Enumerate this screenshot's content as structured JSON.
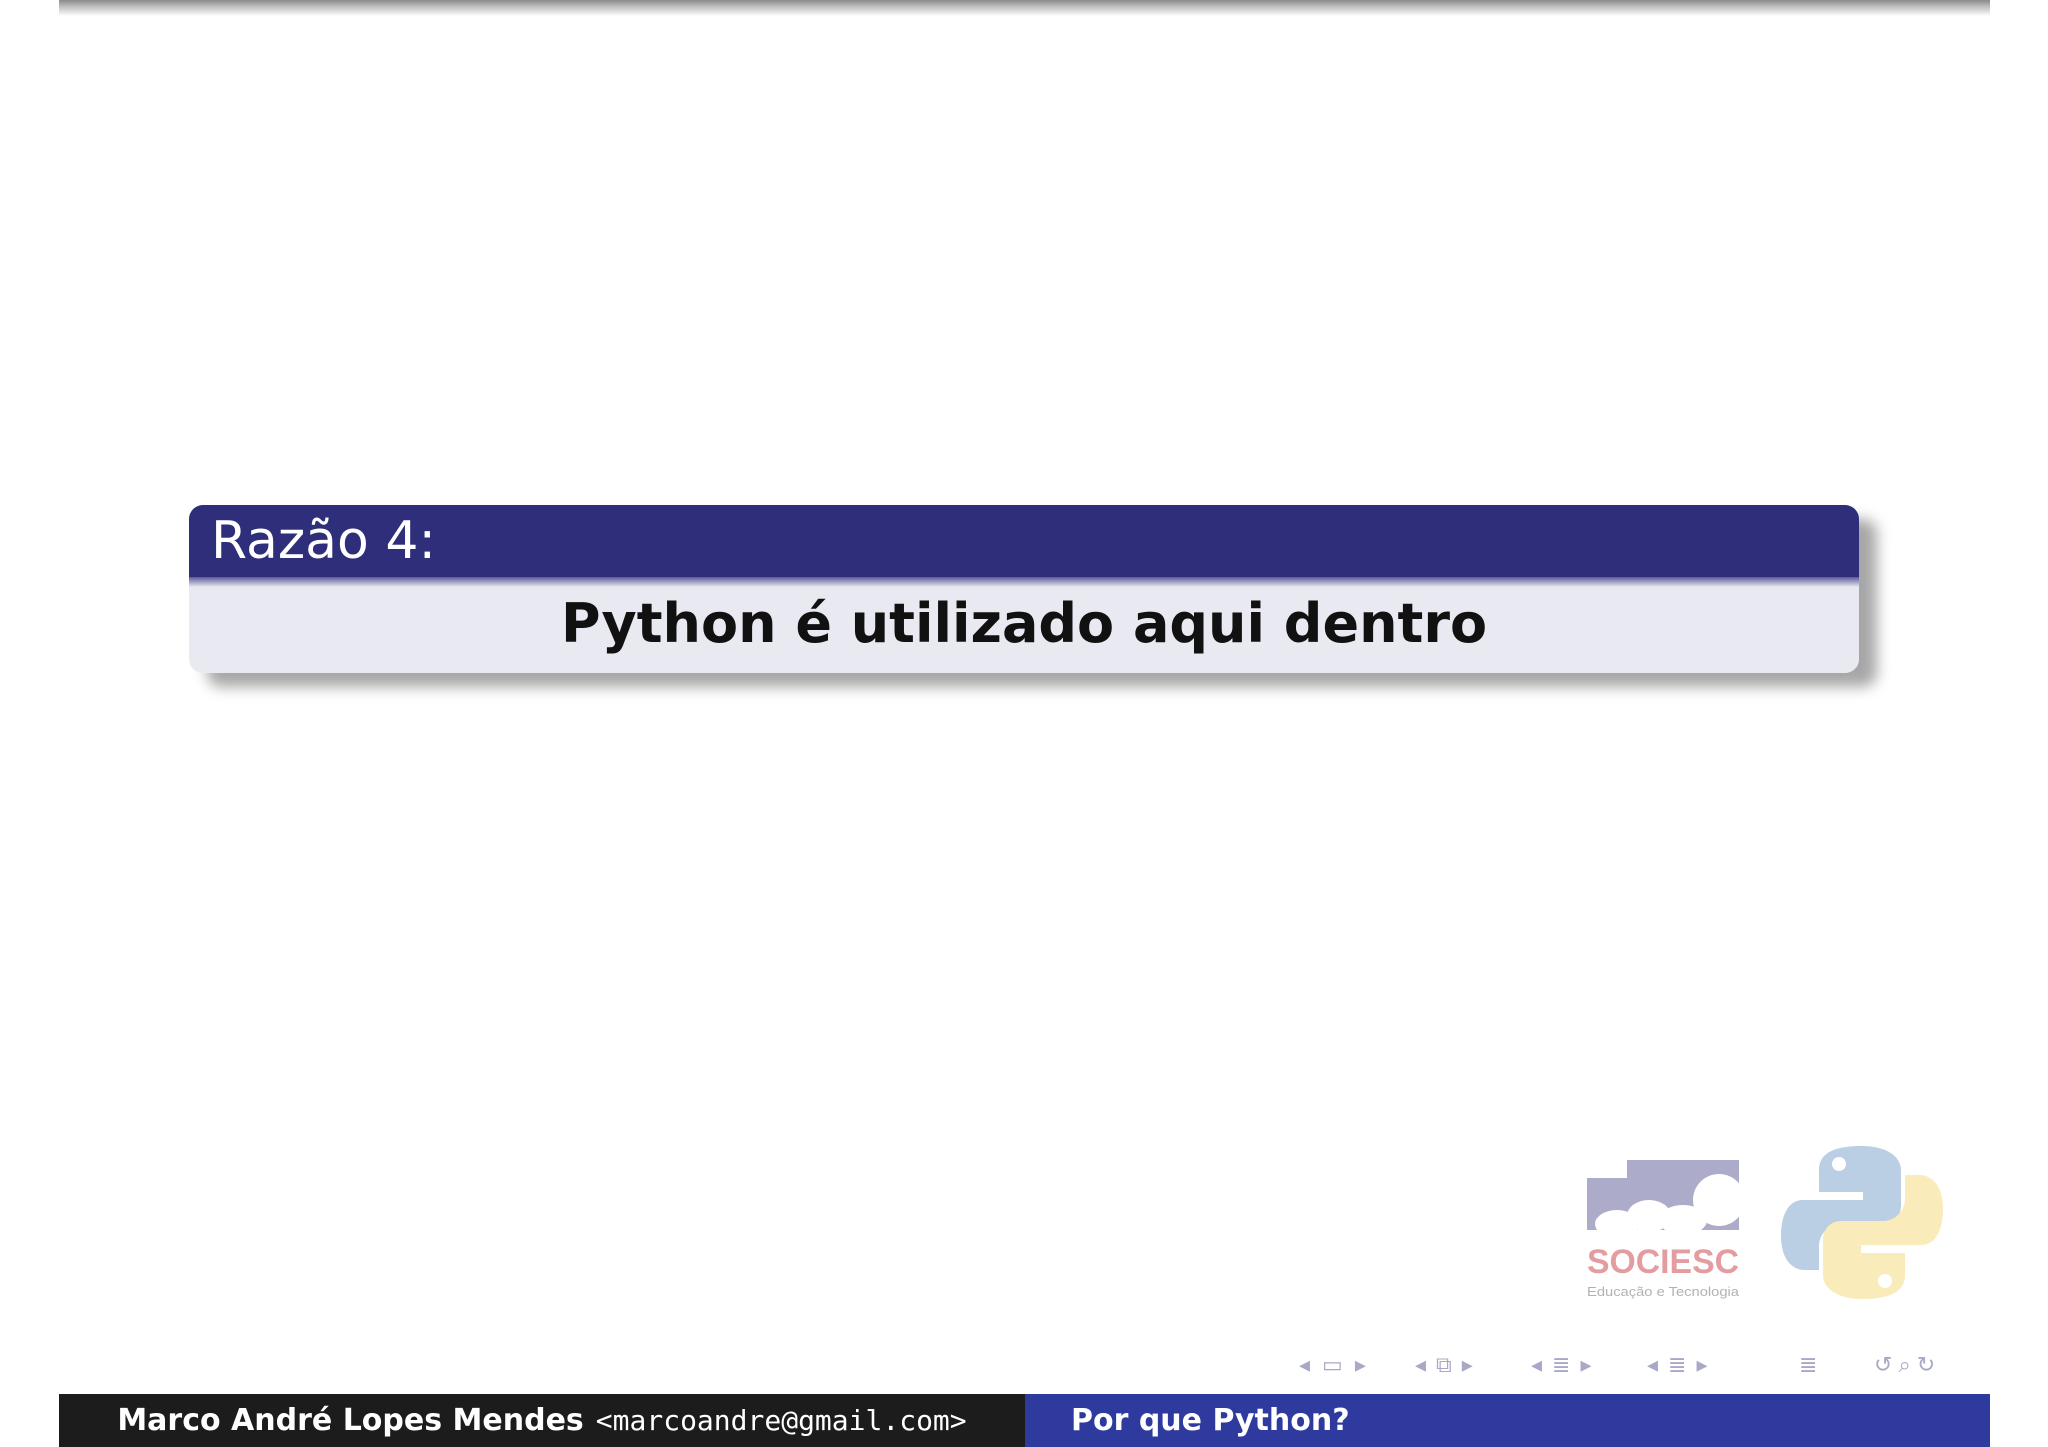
{
  "block": {
    "title": "Razão 4:",
    "body": "Python é utilizado aqui dentro"
  },
  "logos": {
    "sociesc": {
      "name": "SOCIESC",
      "tagline": "Educação e Tecnologia"
    },
    "python_icon": "python-logo-icon"
  },
  "nav": {
    "icons": [
      "frame-prev-icon",
      "frame-icon",
      "frame-next-icon",
      "subsection-prev-icon",
      "subsection-icon",
      "subsection-next-icon",
      "section-prev-icon",
      "section-icon",
      "section-next-icon",
      "slide-prev-icon",
      "slide-list-icon",
      "slide-next-icon",
      "appendix-icon",
      "back-icon",
      "search-icon",
      "forward-icon"
    ]
  },
  "footer": {
    "author": "Marco André Lopes Mendes",
    "email": "<marcoandre@gmail.com>",
    "title": "Por que Python?"
  },
  "colors": {
    "block_title_bg": "#2e2e7a",
    "block_body_bg": "#e9e9f1",
    "footer_left_bg": "#1c1c1c",
    "footer_right_bg": "#2e3a9e",
    "nav_color": "#a8a8c8"
  }
}
